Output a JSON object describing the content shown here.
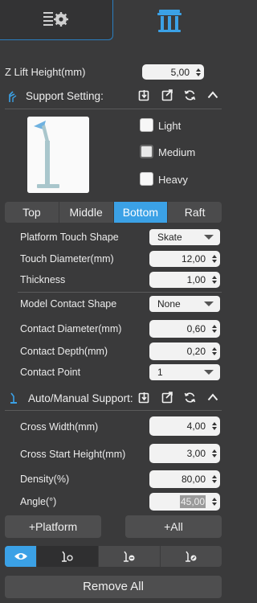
{
  "z_lift": {
    "label": "Z Lift Height(mm)",
    "value": "5,00"
  },
  "support_setting": {
    "title": "Support Setting:"
  },
  "presets": [
    {
      "label": "Light",
      "checked": false
    },
    {
      "label": "Medium",
      "checked": true
    },
    {
      "label": "Heavy",
      "checked": false
    }
  ],
  "tabs": [
    {
      "label": "Top",
      "active": false
    },
    {
      "label": "Middle",
      "active": false
    },
    {
      "label": "Bottom",
      "active": true
    },
    {
      "label": "Raft",
      "active": false
    }
  ],
  "platform": {
    "touch_shape": {
      "label": "Platform Touch Shape",
      "value": "Skate"
    },
    "touch_diameter": {
      "label": "Touch Diameter(mm)",
      "value": "12,00"
    },
    "thickness": {
      "label": "Thickness",
      "value": "1,00"
    }
  },
  "model": {
    "contact_shape": {
      "label": "Model Contact Shape",
      "value": "None"
    },
    "contact_diameter": {
      "label": "Contact Diameter(mm)",
      "value": "0,60"
    },
    "contact_depth": {
      "label": "Contact Depth(mm)",
      "value": "0,20"
    },
    "contact_point": {
      "label": "Contact Point",
      "value": "1"
    }
  },
  "auto_manual": {
    "title": "Auto/Manual Support:"
  },
  "cross": {
    "width": {
      "label": "Cross Width(mm)",
      "value": "4,00"
    },
    "start_height": {
      "label": "Cross Start Height(mm)",
      "value": "3,00"
    },
    "density": {
      "label": "Density(%)",
      "value": "80,00"
    },
    "angle": {
      "label": "Angle(°)",
      "value": "45,00"
    }
  },
  "buttons": {
    "platform": "+Platform",
    "all": "+All",
    "remove_all": "Remove All"
  },
  "colors": {
    "accent": "#3ba1e6",
    "background": "#3a3a3b"
  }
}
